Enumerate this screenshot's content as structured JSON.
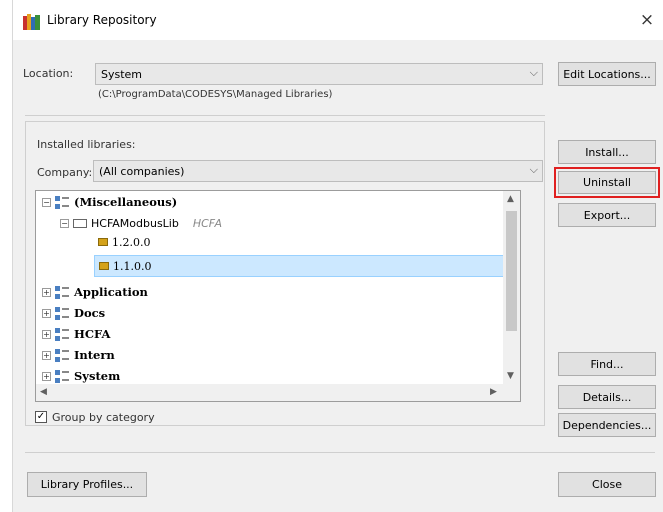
{
  "window": {
    "title": "Library Repository",
    "close_glyph": "×"
  },
  "location": {
    "label": "Location:",
    "value": "System",
    "path": "(C:\\ProgramData\\CODESYS\\Managed Libraries)",
    "edit_button": "Edit Locations..."
  },
  "installed": {
    "label": "Installed libraries:",
    "company_label": "Company:",
    "company_value": "(All companies)",
    "tree": [
      {
        "label": "(Miscellaneous)",
        "expanded": true
      },
      {
        "label": "HCFAModbusLib",
        "company": "HCFA"
      },
      {
        "label": "1.2.0.0"
      },
      {
        "label": "1.1.0.0",
        "selected": true
      },
      {
        "label": "Application"
      },
      {
        "label": "Docs"
      },
      {
        "label": "HCFA"
      },
      {
        "label": "Intern"
      },
      {
        "label": "System"
      }
    ],
    "group_by_label": "Group by category",
    "group_by_checked": true
  },
  "buttons": {
    "install": "Install...",
    "uninstall": "Uninstall",
    "export": "Export...",
    "find": "Find...",
    "details": "Details...",
    "dependencies": "Dependencies...",
    "library_profiles": "Library Profiles...",
    "close": "Close"
  },
  "highlight_color": "#e02020",
  "icons": [
    "library-repository-icon",
    "category-icon",
    "library-icon",
    "version-icon",
    "chevron-down-icon",
    "checkbox-icon"
  ]
}
